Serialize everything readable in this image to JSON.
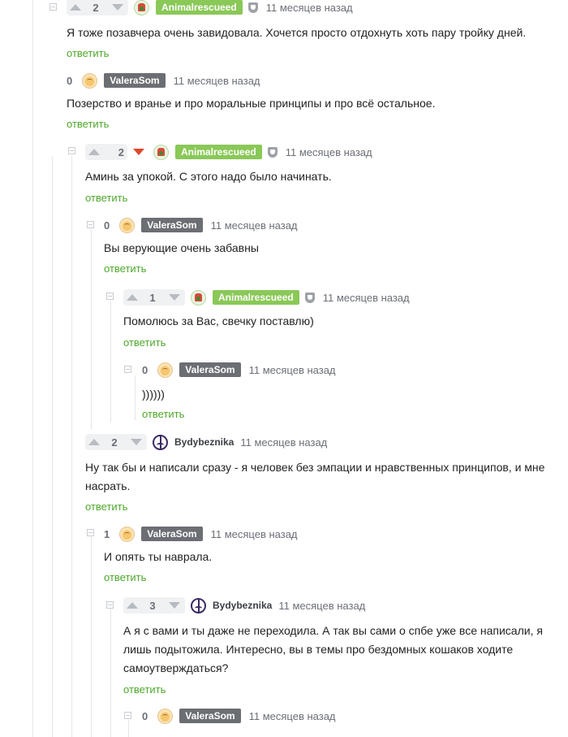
{
  "reply_label": "ответить",
  "comments": [
    {
      "rating": "2",
      "user": "Animalrescueed",
      "time": "11 месяцев назад",
      "text": "Я тоже позавчера очень завидовала. Хочется просто отдохнуть хоть пару тройку дней."
    },
    {
      "rating": "0",
      "user": "ValeraSom",
      "time": "11 месяцев назад",
      "text": "Позерство и вранье и про моральные принципы и про всё остальное."
    },
    {
      "rating": "2",
      "user": "Animalrescueed",
      "time": "11 месяцев назад",
      "text": "Аминь за упокой. С этого надо было начинать."
    },
    {
      "rating": "0",
      "user": "ValeraSom",
      "time": "11 месяцев назад",
      "text": "Вы верующие очень забавны"
    },
    {
      "rating": "1",
      "user": "Animalrescueed",
      "time": "11 месяцев назад",
      "text": "Помолюсь за Вас, свечку поставлю)"
    },
    {
      "rating": "0",
      "user": "ValeraSom",
      "time": "11 месяцев назад",
      "text": "))))))"
    },
    {
      "rating": "2",
      "user": "Bydybeznika",
      "time": "11 месяцев назад",
      "text_lines": [
        "Ну так бы и написали сразу - я человек без эмпации и нравственных принципов, и мне",
        "насрать."
      ]
    },
    {
      "rating": "1",
      "user": "ValeraSom",
      "time": "11 месяцев назад",
      "text": "И опять ты наврала."
    },
    {
      "rating": "3",
      "user": "Bydybeznika",
      "time": "11 месяцев назад",
      "text_lines": [
        "А я с вами и ты даже не переходила. А так вы сами о спбе уже все написали, я",
        "лишь подытожила. Интересно, вы в темы про бездомных кошаков ходите",
        "самоутверждаться?"
      ]
    },
    {
      "rating": "0",
      "user": "ValeraSom",
      "time": "11 месяцев назад"
    }
  ]
}
